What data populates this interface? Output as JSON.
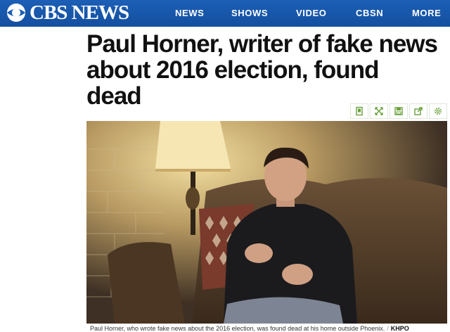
{
  "brand": {
    "name": "CBS NEWS",
    "logo_icon": "cbs-eye-icon"
  },
  "nav": {
    "items": [
      "NEWS",
      "SHOWS",
      "VIDEO",
      "CBSN",
      "MORE"
    ]
  },
  "article": {
    "headline": "Paul Horner, writer of fake news about 2016 election, found dead",
    "photo_caption": "Paul Horner, who wrote fake news about the 2016 election, was found dead at his home outside Phoenix.",
    "photo_credit": "KHPO"
  },
  "tools": [
    "bookmark-icon",
    "expand-icon",
    "save-icon",
    "share-icon",
    "settings-icon"
  ],
  "colors": {
    "nav_bg": "#1c5fb6",
    "tool_icon": "#6aa03a"
  }
}
